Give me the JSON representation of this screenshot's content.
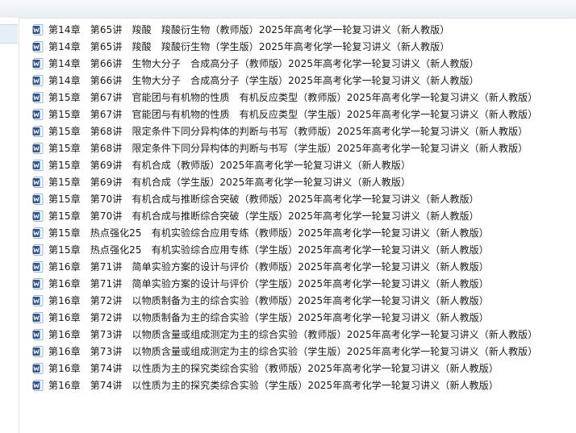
{
  "files": [
    {
      "name": "第14章　第65讲　羧酸　羧酸衍生物（教师版）2025年高考化学一轮复习讲义（新人教版）",
      "icon": "word-doc-icon"
    },
    {
      "name": "第14章　第65讲　羧酸　羧酸衍生物（学生版）2025年高考化学一轮复习讲义（新人教版）",
      "icon": "word-doc-icon"
    },
    {
      "name": "第14章　第66讲　生物大分子　合成高分子（教师版）2025年高考化学一轮复习讲义（新人教版）",
      "icon": "word-doc-icon"
    },
    {
      "name": "第14章　第66讲　生物大分子　合成高分子（学生版）2025年高考化学一轮复习讲义（新人教版）",
      "icon": "word-doc-icon"
    },
    {
      "name": "第15章　第67讲　官能团与有机物的性质　有机反应类型（教师版）2025年高考化学一轮复习讲义（新人教版）",
      "icon": "word-doc-icon"
    },
    {
      "name": "第15章　第67讲　官能团与有机物的性质　有机反应类型（学生版）2025年高考化学一轮复习讲义（新人教版）",
      "icon": "word-doc-icon"
    },
    {
      "name": "第15章　第68讲　限定条件下同分异构体的判断与书写（教师版）2025年高考化学一轮复习讲义（新人教版）",
      "icon": "word-doc-icon"
    },
    {
      "name": "第15章　第68讲　限定条件下同分异构体的判断与书写（学生版）2025年高考化学一轮复习讲义（新人教版）",
      "icon": "word-doc-icon"
    },
    {
      "name": "第15章　第69讲　有机合成（教师版）2025年高考化学一轮复习讲义（新人教版）",
      "icon": "word-doc-icon"
    },
    {
      "name": "第15章　第69讲　有机合成（学生版）2025年高考化学一轮复习讲义（新人教版）",
      "icon": "word-doc-icon"
    },
    {
      "name": "第15章　第70讲　有机合成与推断综合突破（教师版）2025年高考化学一轮复习讲义（新人教版）",
      "icon": "word-doc-icon"
    },
    {
      "name": "第15章　第70讲　有机合成与推断综合突破（学生版）2025年高考化学一轮复习讲义（新人教版）",
      "icon": "word-doc-icon"
    },
    {
      "name": "第15章　热点强化25　有机实验综合应用专练（教师版）2025年高考化学一轮复习讲义（新人教版）",
      "icon": "word-doc-icon"
    },
    {
      "name": "第15章　热点强化25　有机实验综合应用专练（学生版）2025年高考化学一轮复习讲义（新人教版）",
      "icon": "word-doc-icon"
    },
    {
      "name": "第16章　第71讲　简单实验方案的设计与评价（教师版）2025年高考化学一轮复习讲义（新人教版）",
      "icon": "word-doc-icon"
    },
    {
      "name": "第16章　第71讲　简单实验方案的设计与评价（学生版）2025年高考化学一轮复习讲义（新人教版）",
      "icon": "word-doc-icon"
    },
    {
      "name": "第16章　第72讲　以物质制备为主的综合实验（教师版）2025年高考化学一轮复习讲义（新人教版）",
      "icon": "word-doc-icon"
    },
    {
      "name": "第16章　第72讲　以物质制备为主的综合实验（学生版）2025年高考化学一轮复习讲义（新人教版）",
      "icon": "word-doc-icon"
    },
    {
      "name": "第16章　第73讲　以物质含量或组成测定为主的综合实验（教师版）2025年高考化学一轮复习讲义（新人教版）",
      "icon": "word-doc-icon"
    },
    {
      "name": "第16章　第73讲　以物质含量或组成测定为主的综合实验（学生版）2025年高考化学一轮复习讲义（新人教版）",
      "icon": "word-doc-icon"
    },
    {
      "name": "第16章　第74讲　以性质为主的探究类综合实验（教师版）2025年高考化学一轮复习讲义（新人教版）",
      "icon": "word-doc-icon"
    },
    {
      "name": "第16章　第74讲　以性质为主的探究类综合实验（学生版）2025年高考化学一轮复习讲义（新人教版）",
      "icon": "word-doc-icon"
    }
  ],
  "colors": {
    "word_blue": "#2b579a",
    "text": "#1a1a1a"
  }
}
